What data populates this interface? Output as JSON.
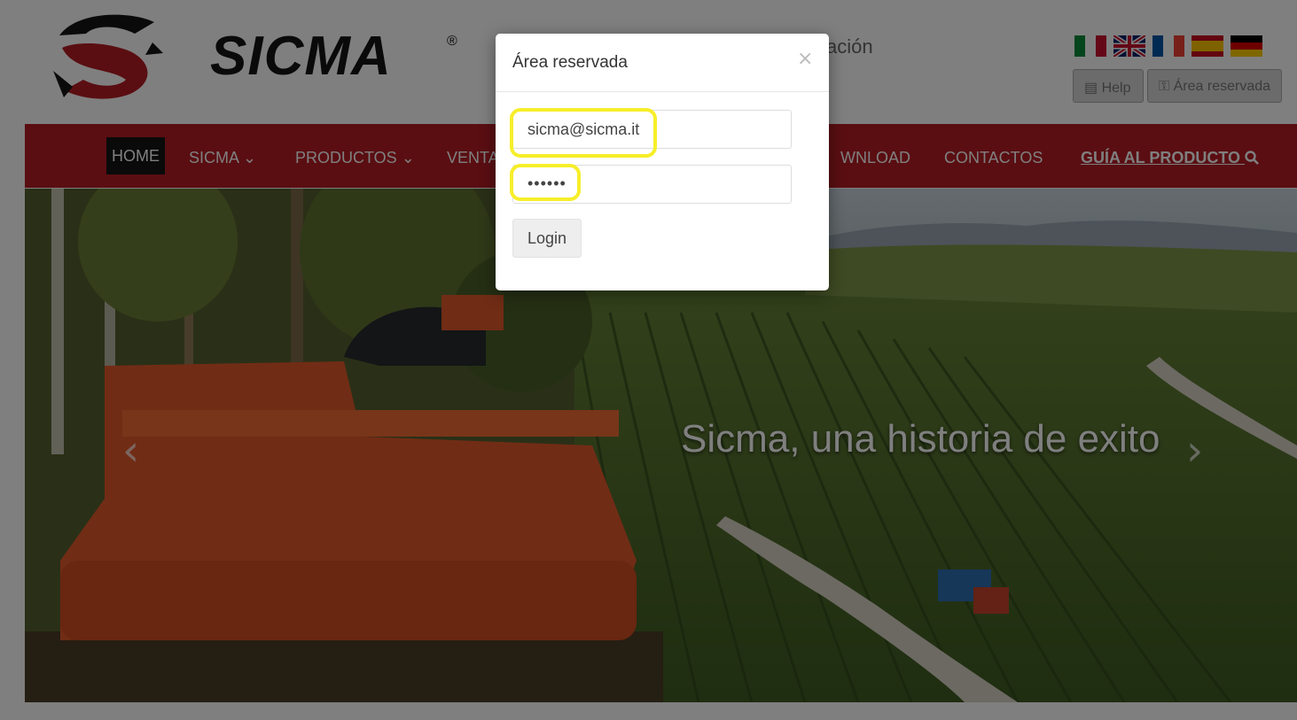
{
  "header": {
    "logo_text": "SICMA",
    "registered_mark": "®",
    "partial_text": "ación",
    "flags": [
      "italian-flag",
      "uk-flag",
      "french-flag",
      "spanish-flag",
      "german-flag"
    ],
    "help_label": "Help",
    "reserved_label": "Área reservada"
  },
  "nav": {
    "items": [
      "HOME",
      "SICMA",
      "PRODUCTOS",
      "VENTA",
      "WNLOAD",
      "CONTACTOS",
      "GUÍA AL PRODUCTO"
    ],
    "chevron": "⌄"
  },
  "hero": {
    "caption": "Sicma, una historia de exito",
    "prev_arrow": "‹",
    "next_arrow": "›"
  },
  "modal": {
    "title": "Área reservada",
    "close": "×",
    "email_value": "sicma@sicma.it",
    "password_value": "••••••",
    "login_label": "Login"
  },
  "colors": {
    "nav_red": "#b51c24",
    "highlight_yellow": "#f7ee2a"
  }
}
